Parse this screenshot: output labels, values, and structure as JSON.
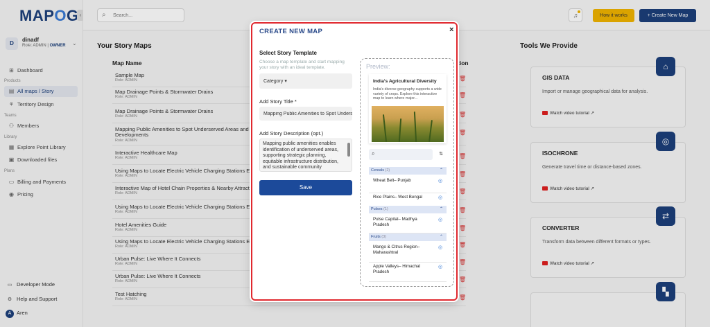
{
  "app": {
    "logo_left": "MAP",
    "logo_o": "O",
    "logo_right": "G"
  },
  "user": {
    "initial": "D",
    "name": "dinadf",
    "role_prefix": "Role: ADMIN | ",
    "role_owner": "OWNER"
  },
  "sidebar": {
    "items": [
      {
        "label": "Dashboard",
        "icon": "dashboard-icon",
        "glyph": "⊞"
      },
      {
        "label": "All maps / Story",
        "icon": "maps-icon",
        "glyph": "▤"
      },
      {
        "label": "Territory Design",
        "icon": "territory-icon",
        "glyph": "⚘"
      },
      {
        "label": "Members",
        "icon": "members-icon",
        "glyph": "⚇"
      },
      {
        "label": "Explore Point Library",
        "icon": "library-icon",
        "glyph": "▦"
      },
      {
        "label": "Downloaded files",
        "icon": "download-icon",
        "glyph": "▣"
      },
      {
        "label": "Billing and Payments",
        "icon": "billing-icon",
        "glyph": "▭"
      },
      {
        "label": "Pricing",
        "icon": "pricing-icon",
        "glyph": "◉"
      }
    ],
    "sections": {
      "products": "Products",
      "teams": "Teams",
      "library": "Library",
      "plans": "Plans"
    },
    "bottom": {
      "developer": "Developer Mode",
      "help": "Help and Support",
      "account_initial": "A",
      "account": "Aren"
    }
  },
  "topbar": {
    "search_placeholder": "Search...",
    "how_it_works": "How it works",
    "create_new_map": "+  Create New Map"
  },
  "main": {
    "title": "Your Story Maps",
    "column": "Map Name",
    "column_action": "tion",
    "rows": [
      {
        "name": "Sample Map",
        "role": "Role: ADMIN"
      },
      {
        "name": "Map Drainage Points & Stormwater Drains",
        "role": "Role: ADMIN"
      },
      {
        "name": "Map Drainage Points & Stormwater Drains",
        "role": "Role: ADMIN"
      },
      {
        "name": "Mapping Public Amenities to Spot Underserved Areas and Plan",
        "name2": "Developments",
        "role": "Role: ADMIN"
      },
      {
        "name": "Interactive Healthcare Map",
        "role": "Role: ADMIN"
      },
      {
        "name": "Using Maps to Locate Electric Vehicle Charging Stations Easily",
        "role": "Role: ADMIN"
      },
      {
        "name": "Interactive Map of Hotel Chain Properties & Nearby Attractions",
        "role": "Role: ADMIN"
      },
      {
        "name": "Using Maps to Locate Electric Vehicle Charging Stations Easily",
        "role": "Role: ADMIN"
      },
      {
        "name": "Hotel Amenities Guide",
        "role": "Role: ADMIN"
      },
      {
        "name": "Using Maps to Locate Electric Vehicle Charging Stations Easily",
        "role": "Role: ADMIN"
      },
      {
        "name": "Urban Pulse: Live Where It Connects",
        "role": "Role: ADMIN"
      },
      {
        "name": "Urban Pulse: Live Where It Connects",
        "role": "Role: ADMIN"
      },
      {
        "name": "Test Hatching",
        "role": "Role: ADMIN"
      }
    ]
  },
  "tools": {
    "title": "Tools We Provide",
    "cards": [
      {
        "title": "GIS DATA",
        "desc": "Import or manage geographical data for analysis.",
        "video": "Watch video tutorial  ↗",
        "icon": "gis-data-icon",
        "glyph": "⌂"
      },
      {
        "title": "ISOCHRONE",
        "desc": "Generate travel time or distance-based zones.",
        "video": "Watch video tutorial  ↗",
        "icon": "isochrone-icon",
        "glyph": "◎"
      },
      {
        "title": "CONVERTER",
        "desc": "Transform data between different formats or types.",
        "video": "Watch video tutorial  ↗",
        "icon": "converter-icon",
        "glyph": "⇄"
      },
      {
        "title": "",
        "desc": "",
        "video": "",
        "icon": "tool-icon",
        "glyph": "▚"
      }
    ]
  },
  "modal": {
    "title": "CREATE NEW MAP",
    "close": "×",
    "template_label": "Select Story Template",
    "template_hint": "Choose a map template and start mapping your story with an ideal template.",
    "category": "Category ▾",
    "story_title_label": "Add Story Title *",
    "story_title_value": "Mapping Public Amenities to Spot Underserved Areas",
    "desc_label": "Add Story Description (opt.)",
    "desc_value": "Mapping public amenities enables identification of underserved areas, supporting strategic planning, equitable infrastructure distribution, and sustainable community development.",
    "save": "Save"
  },
  "preview": {
    "label": "Preview:",
    "card_title": "India's Agricultural Diversity",
    "card_desc": "India's diverse geography supports a wide variety of crops. Explore this interactive map to learn where major...",
    "filter_icon": "⇅",
    "categories": [
      {
        "name": "Cereals",
        "count": "(2)"
      },
      {
        "name": "Pulses",
        "count": "(1)"
      },
      {
        "name": "Fruits",
        "count": "(3)"
      }
    ],
    "items": [
      "Wheat Belt– Punjab",
      "Rice Plains– West Bengal",
      "Pulse Capital– Madhya Pradesh",
      "Mango & Citrus Region– Maharashtral",
      "Apple Valleys– Himachal Pradesh"
    ]
  }
}
